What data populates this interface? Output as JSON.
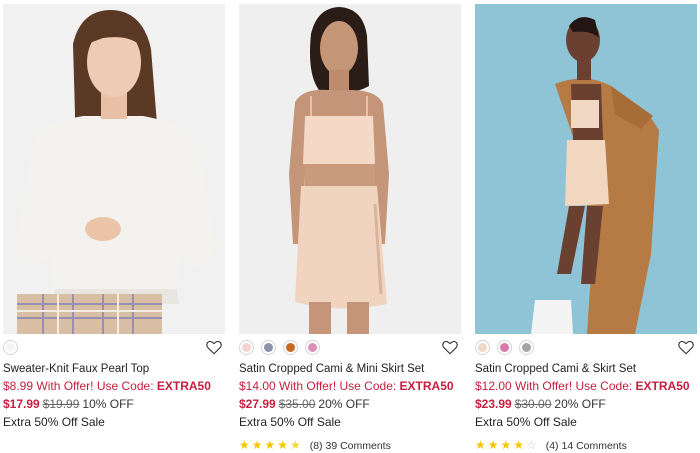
{
  "products": [
    {
      "name": "Sweater-Knit Faux Pearl Top",
      "offer_price": "$8.99",
      "offer_text": "With Offer! Use Code:",
      "offer_code": "EXTRA50",
      "sale_price": "$17.99",
      "original_price": "$19.99",
      "discount": "10% OFF",
      "promo": "Extra 50% Off Sale",
      "swatches": [
        "#f5f5f5"
      ],
      "image": "model-white-sweater-icon"
    },
    {
      "name": "Satin Cropped Cami & Mini Skirt Set",
      "offer_price": "$14.00",
      "offer_text": "With Offer! Use Code:",
      "offer_code": "EXTRA50",
      "sale_price": "$27.99",
      "original_price": "$35.00",
      "discount": "20% OFF",
      "promo": "Extra 50% Off Sale",
      "swatches": [
        "#f2d4d2",
        "#8d93aa",
        "#c86a22",
        "#dd8fb9"
      ],
      "rating_stars": 4.5,
      "rating_count": "(8)",
      "comments": "39 Comments",
      "image": "model-satin-set-icon"
    },
    {
      "name": "Satin Cropped Cami & Skirt Set",
      "offer_price": "$12.00",
      "offer_text": "With Offer! Use Code:",
      "offer_code": "EXTRA50",
      "sale_price": "$23.99",
      "original_price": "$30.00",
      "discount": "20% OFF",
      "promo": "Extra 50% Off Sale",
      "swatches": [
        "#efd7c9",
        "#d978aa",
        "#a4a4a4"
      ],
      "rating_stars": 4,
      "rating_count": "(4)",
      "comments": "14 Comments",
      "image": "model-satin-coat-icon"
    }
  ],
  "colors": {
    "accent": "#c51f3d",
    "star": "#f5c500"
  }
}
